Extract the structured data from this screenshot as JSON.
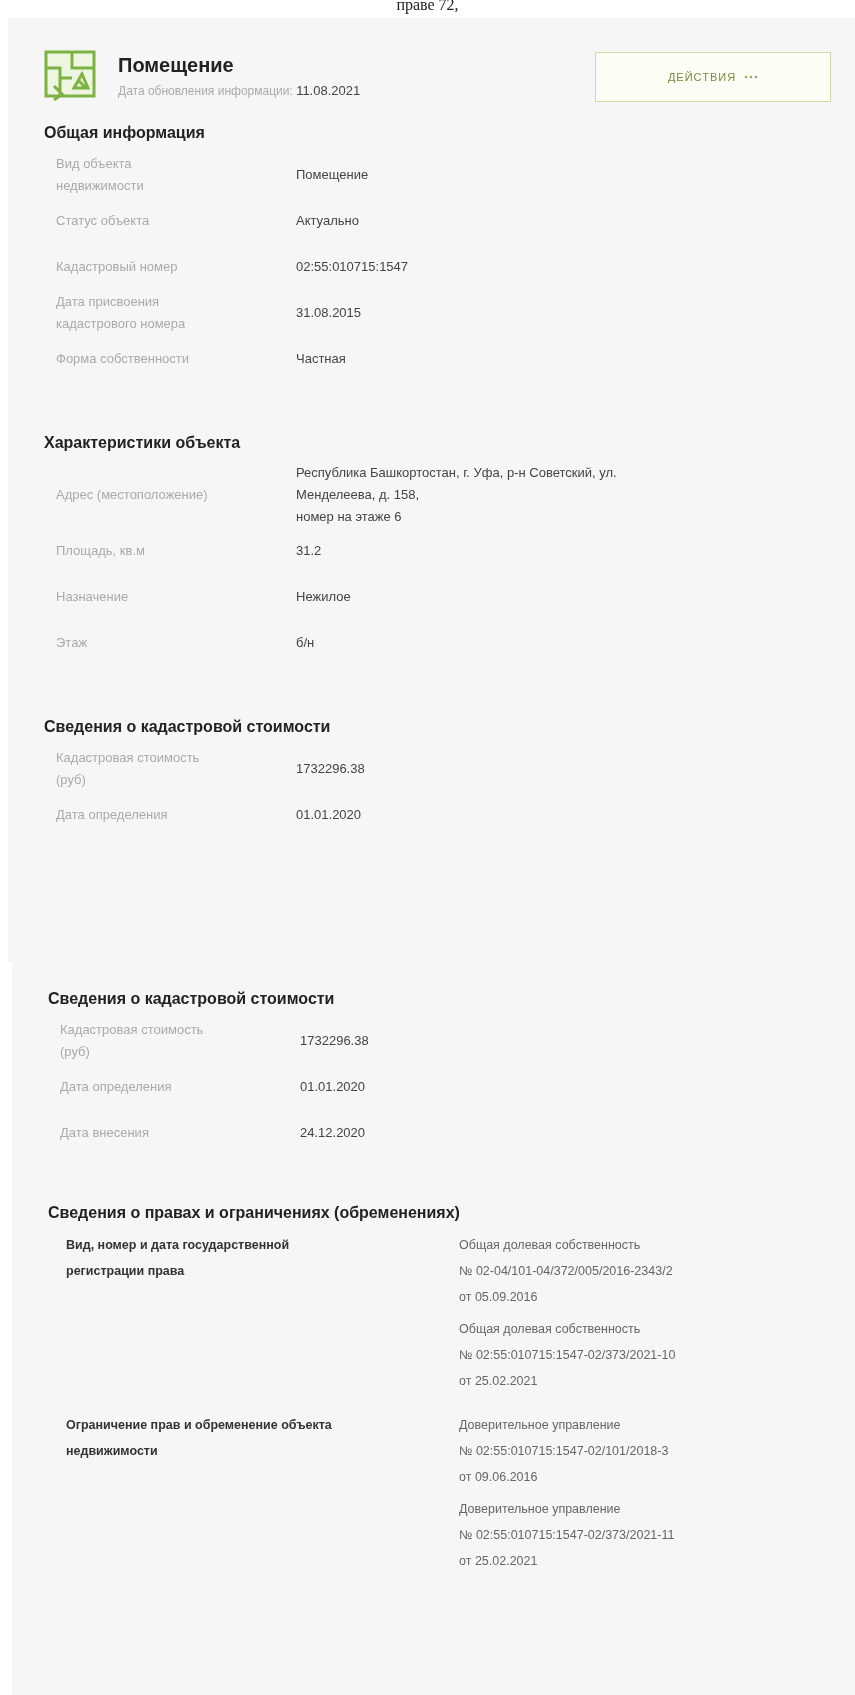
{
  "top_text": "праве 72,",
  "header": {
    "title": "Помещение",
    "updated_label": "Дата обновления информации:",
    "updated_value": "11.08.2021",
    "button": "ДЕЙСТВИЯ"
  },
  "panels": [
    {
      "sections": [
        {
          "kind": "fields",
          "title": "Общая информация",
          "rows": [
            {
              "label": "Вид объекта недвижимости",
              "value": [
                "Помещение"
              ]
            },
            {
              "label": "Статус объекта",
              "value": [
                "Актуально"
              ]
            },
            {
              "label": "Кадастровый номер",
              "value": [
                "02:55:010715:1547"
              ]
            },
            {
              "label": "Дата присвоения кадастрового номера",
              "value": [
                "31.08.2015"
              ]
            },
            {
              "label": "Форма собственности",
              "value": [
                "Частная"
              ]
            }
          ]
        },
        {
          "kind": "fields",
          "title": "Характеристики объекта",
          "rows": [
            {
              "label": "Адрес (местоположение)",
              "value": [
                "Республика Башкортостан, г. Уфа, р-н Советский, ул. Менделеева, д. 158,",
                "номер на этаже 6"
              ]
            },
            {
              "label": "Площадь, кв.м",
              "value": [
                "31.2"
              ]
            },
            {
              "label": "Назначение",
              "value": [
                "Нежилое"
              ]
            },
            {
              "label": "Этаж",
              "value": [
                "б/н"
              ]
            }
          ]
        },
        {
          "kind": "fields",
          "title": "Сведения о кадастровой стоимости",
          "rows": [
            {
              "label": "Кадастровая стоимость (руб)",
              "value": [
                "1732296.38"
              ]
            },
            {
              "label": "Дата определения",
              "value": [
                "01.01.2020"
              ]
            }
          ]
        }
      ]
    },
    {
      "sections": [
        {
          "kind": "fields",
          "title": "Сведения о кадастровой стоимости",
          "rows": [
            {
              "label": "Кадастровая стоимость (руб)",
              "value": [
                "1732296.38"
              ]
            },
            {
              "label": "Дата определения",
              "value": [
                "01.01.2020"
              ]
            },
            {
              "label": "Дата внесения",
              "value": [
                "24.12.2020"
              ]
            }
          ]
        },
        {
          "kind": "rights",
          "title": "Сведения о правах и ограничениях (обременениях)",
          "rows": [
            {
              "label": "Вид, номер и дата государственной регистрации права",
              "entries": [
                [
                  "Общая долевая собственность",
                  "№ 02-04/101-04/372/005/2016-2343/2",
                  "от 05.09.2016"
                ],
                [
                  "Общая долевая собственность",
                  "№ 02:55:010715:1547-02/373/2021-10",
                  "от 25.02.2021"
                ]
              ]
            },
            {
              "label": "Ограничение прав и обременение объекта недвижимости",
              "entries": [
                [
                  "Доверительное управление",
                  "№ 02:55:010715:1547-02/101/2018-3",
                  "от 09.06.2016"
                ],
                [
                  "Доверительное управление",
                  "№ 02:55:010715:1547-02/373/2021-11",
                  "от 25.02.2021"
                ]
              ]
            }
          ]
        }
      ]
    }
  ]
}
